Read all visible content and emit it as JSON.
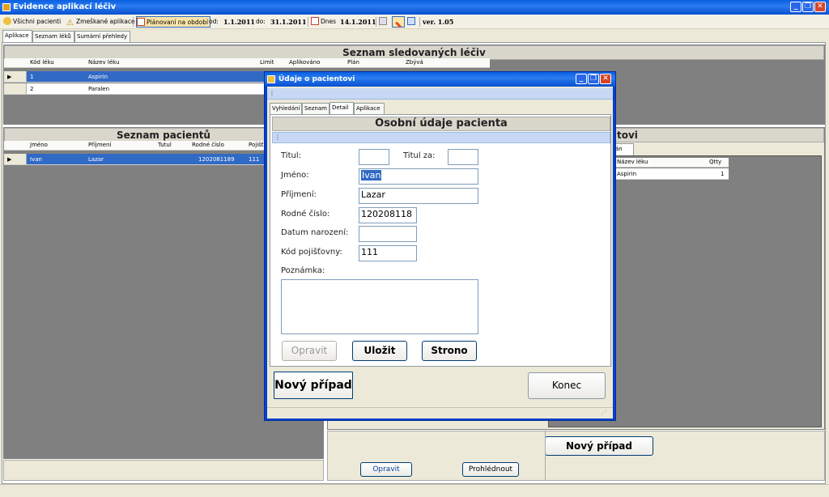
{
  "window": {
    "title": "Evidence aplikací léčiv"
  },
  "toolbar": {
    "all_patients": "Všichni pacienti",
    "missed": "Zmeškané aplikace",
    "planning": "Plánovaní na období",
    "from_label": "od:",
    "from_value": "1.1.2011",
    "to_label": "do:",
    "to_value": "31.1.2011",
    "today_label": "Dnes",
    "today_value": "14.1.2011",
    "version": "ver. 1.05"
  },
  "main_tabs": [
    "Aplikace",
    "Seznam léků",
    "Sumární přehledy"
  ],
  "drugs": {
    "title": "Seznam sledovaných léčiv",
    "columns": [
      "Kód léku",
      "Název léku",
      "Limit",
      "Aplikováno",
      "Plán",
      "Zbývá"
    ],
    "rows": [
      {
        "code": "1",
        "name": "Aspirin"
      },
      {
        "code": "2",
        "name": "Paralen"
      }
    ]
  },
  "patients": {
    "title": "Seznam pacientů",
    "columns": [
      "Jméno",
      "Příjmení",
      "Tutul",
      "Rodné číslo",
      "Pojišť"
    ],
    "rows": [
      {
        "name": "Ivan",
        "surname": "Lazar",
        "rc": "1202081189",
        "ins": "111"
      }
    ]
  },
  "patient_apps": {
    "title_fragment": "tovi",
    "tab_fragment": "án",
    "columns": [
      "Název léku",
      "Qtty"
    ],
    "rows": [
      {
        "drug": "Aspirin",
        "qty": "1"
      }
    ],
    "new_case": "Nový případ",
    "edit": "Opravit",
    "view": "Prohlédnout"
  },
  "dialog": {
    "title": "Údaje o pacientovi",
    "tabs": [
      "Vyhledání",
      "Seznam",
      "Detail",
      "Aplikace"
    ],
    "section_title": "Osobní údaje pacienta",
    "labels": {
      "titul": "Titul:",
      "titul_za": "Titul za:",
      "jmeno": "Jméno:",
      "prijmeni": "Příjmení:",
      "rc": "Rodné číslo:",
      "datum": "Datum narození:",
      "pojistovna": "Kód pojišťovny:",
      "poznamka": "Poznámka:"
    },
    "values": {
      "titul": "",
      "titul_za": "",
      "jmeno": "Ivan",
      "prijmeni": "Lazar",
      "rc": "120208118",
      "datum": "",
      "pojistovna": "111",
      "poznamka": ""
    },
    "buttons": {
      "opravit": "Opravit",
      "ulozit": "Uložit",
      "strono": "Strono",
      "novy": "Nový případ",
      "konec": "Konec"
    }
  },
  "colors": {
    "selection": "#316ac5",
    "titlebar": "#0a5fe0",
    "close": "#d8462a"
  }
}
